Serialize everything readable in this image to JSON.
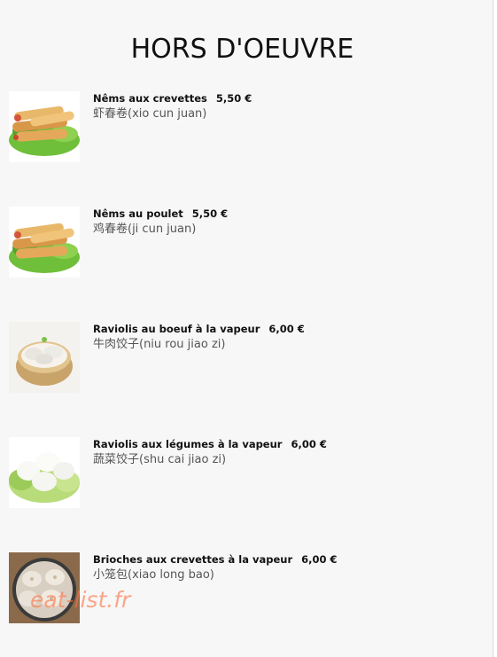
{
  "header": {
    "title": "HORS D'OEUVRE"
  },
  "menu": {
    "items": [
      {
        "name": "Nêms aux crevettes",
        "price": "5,50 €",
        "chinese": "虾春卷(xio cun juan)",
        "image": "spring-rolls-icon"
      },
      {
        "name": "Nêms au poulet",
        "price": "5,50 €",
        "chinese": "鸡春卷(ji cun juan)",
        "image": "spring-rolls-icon"
      },
      {
        "name": "Raviolis au boeuf à la vapeur",
        "price": "6,00 €",
        "chinese": "牛肉饺子(niu rou jiao zi)",
        "image": "dumpling-basket-icon"
      },
      {
        "name": "Raviolis aux légumes à la vapeur",
        "price": "6,00 €",
        "chinese": "蔬菜饺子(shu cai jiao zi)",
        "image": "dumplings-on-lettuce-icon"
      },
      {
        "name": "Brioches aux crevettes à la vapeur",
        "price": "6,00 €",
        "chinese": "小笼包(xiao long bao)",
        "image": "steamed-buns-icon"
      }
    ]
  },
  "watermark": {
    "text": "eat-list.fr",
    "color": "#ff6f3f"
  }
}
